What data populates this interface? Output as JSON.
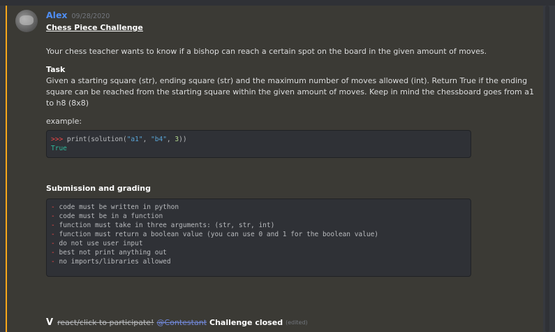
{
  "author": {
    "name": "Alex",
    "timestamp": "09/28/2020"
  },
  "post": {
    "title": "Chess Piece Challenge",
    "intro": "Your chess teacher wants to know if a bishop can reach a certain spot on the board in the given amount of moves.",
    "task_heading": "Task",
    "task_body": "Given a starting square (str), ending square (str) and the maximum number of moves allowed (int). Return True if the ending square can be reached from the starting square within the given amount of moves. Keep in mind the chessboard goes from a1 to h8 (8x8)",
    "example_label": "example:",
    "example_code": {
      "prompt": ">>>",
      "call_prefix": " print(solution(",
      "arg1": "\"a1\"",
      "sep1": ", ",
      "arg2": "\"b4\"",
      "sep2": ", ",
      "arg3": "3",
      "call_suffix": "))",
      "output": "True"
    },
    "submission_heading": "Submission and grading",
    "rules_bullet": "-",
    "rules": [
      "code must be written in python",
      "code must be in a function",
      "function must take in three arguments: (str, str, int)",
      "function must return a boolean value (you can use 0 and 1 for the boolean value)",
      "do not use user input",
      "best not print anything out",
      "no imports/libraries allowed"
    ],
    "footer": {
      "check": "V",
      "react_text": "react/click to participate!",
      "mention": "@Contestant",
      "closed_text": "Challenge closed",
      "edited": "(edited)"
    }
  },
  "colors": {
    "background": "#36393f",
    "highlight": "#faa61a",
    "username": "#4f8ef5",
    "mention": "#7289da"
  }
}
